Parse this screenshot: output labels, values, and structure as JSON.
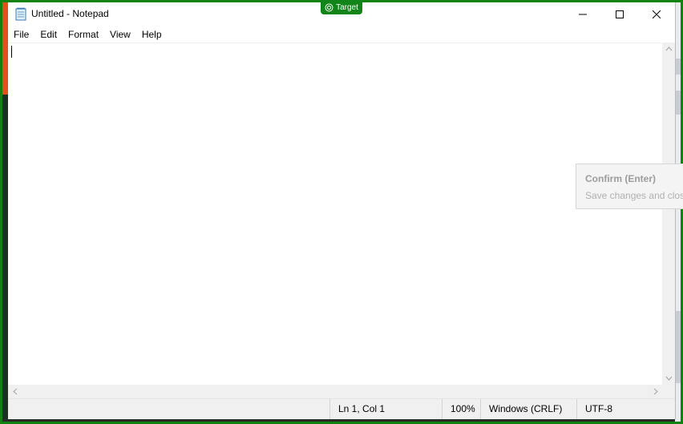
{
  "window": {
    "title": "Untitled - Notepad",
    "icon": "notepad-icon",
    "controls": {
      "minimize": "minimize-icon",
      "maximize": "maximize-icon",
      "close": "close-icon"
    }
  },
  "menu": [
    "File",
    "Edit",
    "Format",
    "View",
    "Help"
  ],
  "editor": {
    "content": ""
  },
  "statusbar": {
    "position": "Ln 1, Col 1",
    "zoom": "100%",
    "line_ending": "Windows (CRLF)",
    "encoding": "UTF-8"
  },
  "overlay": {
    "target_label": "Target",
    "tooltip_title": "Confirm (Enter)",
    "tooltip_desc": "Save changes and close"
  },
  "colors": {
    "frame_green": "#10820f",
    "badge_green": "#12851a",
    "accent_orange": "#e0521b"
  }
}
